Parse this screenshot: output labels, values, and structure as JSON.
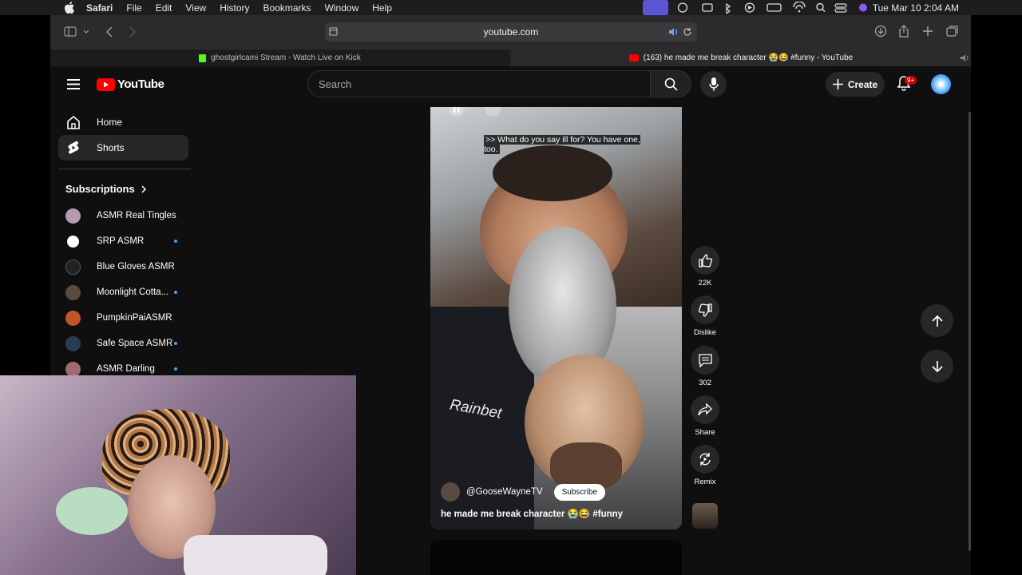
{
  "menubar": {
    "app": "Safari",
    "items": [
      "File",
      "Edit",
      "View",
      "History",
      "Bookmarks",
      "Window",
      "Help"
    ],
    "clock": "Tue Mar 10  2:04 AM"
  },
  "browser": {
    "url": "youtube.com",
    "tabs": [
      {
        "title": "ghostgirlcami Stream - Watch Live on Kick",
        "icon": "kick-icon"
      },
      {
        "title": "(163) he made me break character 😭😂 #funny - YouTube",
        "icon": "youtube-icon"
      }
    ]
  },
  "youtube": {
    "logo_text": "YouTube",
    "search_placeholder": "Search",
    "create_label": "Create",
    "notif_badge": "9+",
    "sidebar": {
      "items": [
        {
          "label": "Home",
          "icon": "home-icon"
        },
        {
          "label": "Shorts",
          "icon": "shorts-icon"
        }
      ],
      "subscriptions_title": "Subscriptions",
      "subscriptions": [
        {
          "name": "ASMR Real Tingles",
          "live_dot": false,
          "color": "#b49cb0"
        },
        {
          "name": "SRP ASMR",
          "live_dot": true,
          "color": "#ffffff"
        },
        {
          "name": "Blue Gloves ASMR",
          "live_dot": false,
          "color": "#222222"
        },
        {
          "name": "Moonlight Cotta...",
          "live_dot": true,
          "color": "#5c4a3b"
        },
        {
          "name": "PumpkinPaiASMR",
          "live_dot": false,
          "color": "#c0552b"
        },
        {
          "name": "Safe Space ASMR",
          "live_dot": true,
          "color": "#2b3a55"
        },
        {
          "name": "ASMR Darling",
          "live_dot": true,
          "color": "#a06a70"
        }
      ]
    },
    "short": {
      "caption": ">> What do you say ill for? You have one, too.",
      "channel": "@GooseWayneTV",
      "subscribe_label": "Subscribe",
      "title": "he made me break character 😭😂 #funny",
      "shirt_text": "Rainbet"
    },
    "actions": {
      "likes": "22K",
      "dislike_label": "Dislike",
      "comments": "302",
      "share_label": "Share",
      "remix_label": "Remix"
    }
  },
  "colors": {
    "accent_red": "#ff0000",
    "link_blue": "#3ea6ff"
  }
}
